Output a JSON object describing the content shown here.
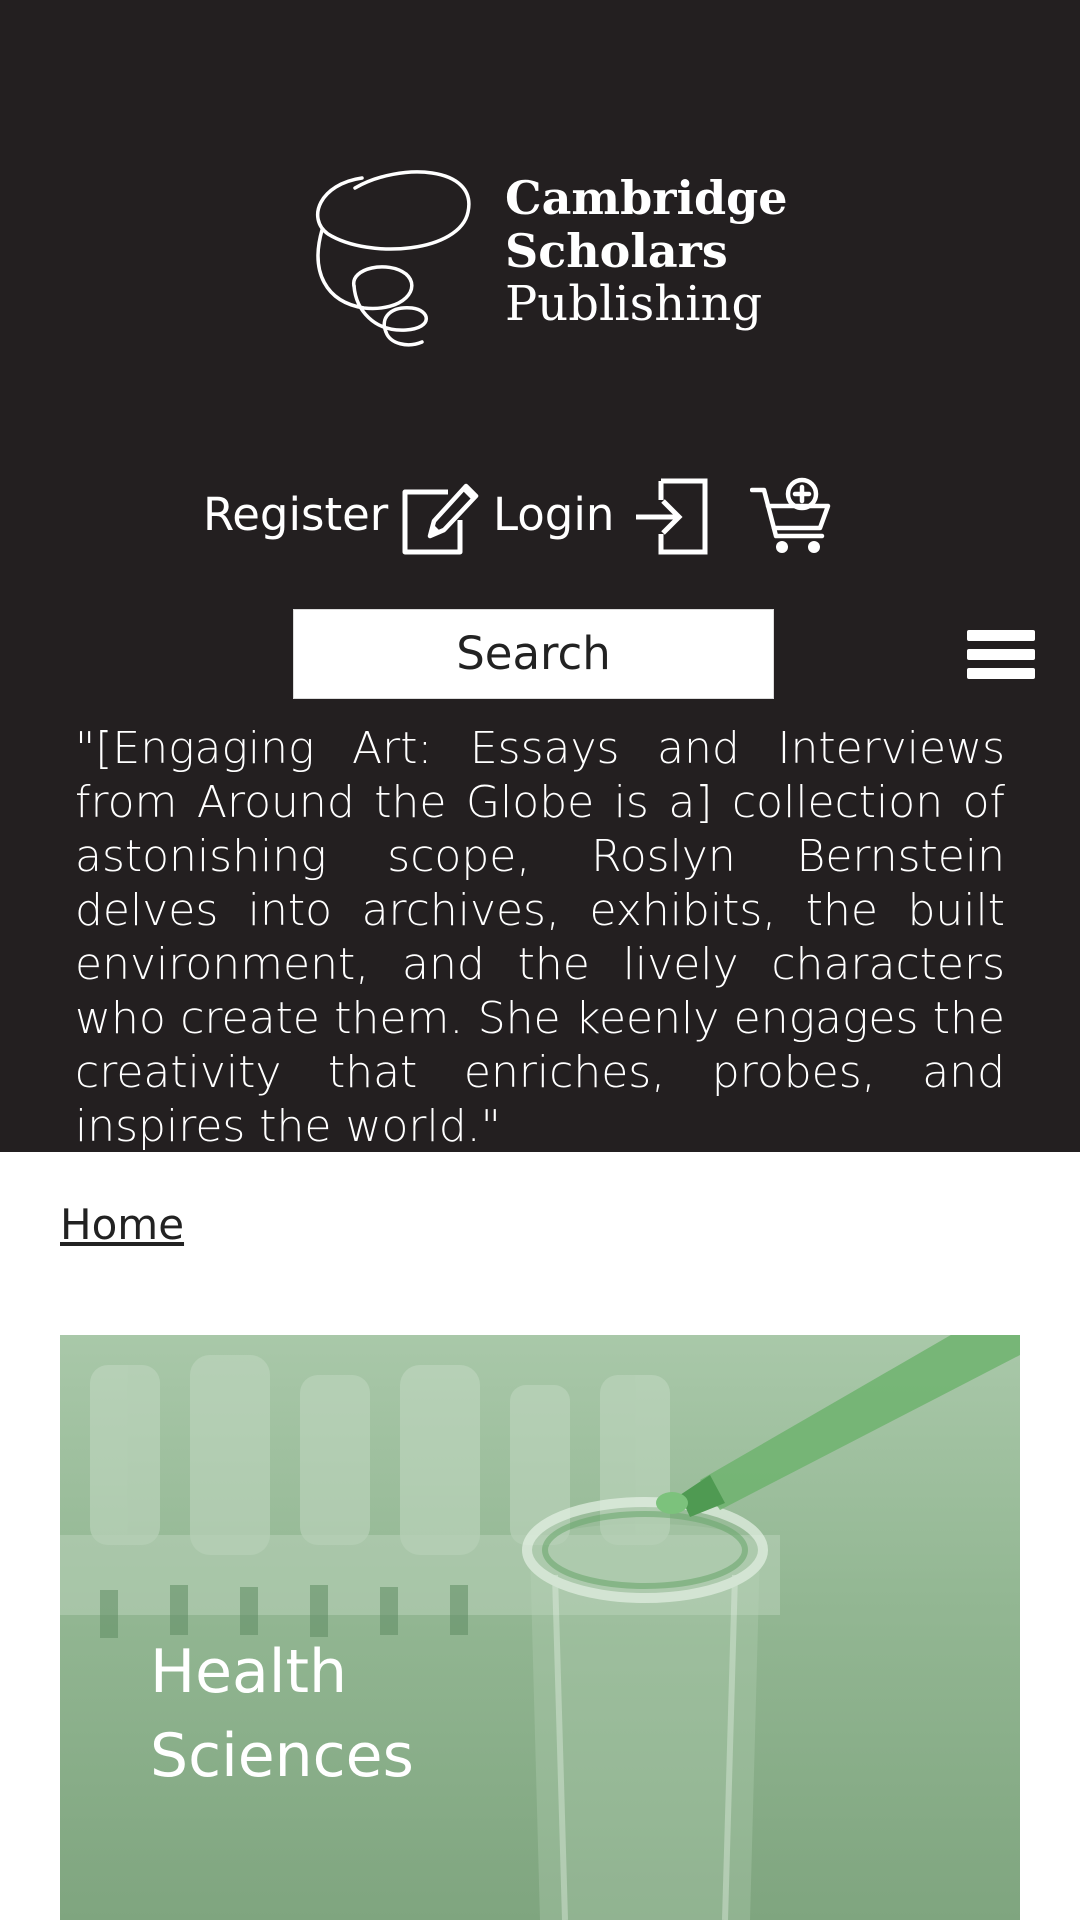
{
  "brand": {
    "line1": "Cambridge",
    "line2": "Scholars",
    "line3": "Publishing"
  },
  "account": {
    "register_label": "Register",
    "login_label": "Login",
    "icons": [
      "edit-icon",
      "login-icon",
      "cart-icon"
    ]
  },
  "search": {
    "placeholder": "Search"
  },
  "quote": {
    "text": "\"[Engaging Art: Essays and Interviews from Around the Globe is a] collection of astonishing scope, Roslyn Bernstein delves into archives, exhibits, the built environment, and the lively characters who create them. She keenly engages the creativity that enriches, probes, and inspires the world.\""
  },
  "breadcrumb": {
    "home_label": "Home"
  },
  "category": {
    "title": "Health Sciences"
  },
  "colors": {
    "header_bg": "#231f20",
    "card_tint": "#8fb48f",
    "text_light": "#ffffff"
  }
}
